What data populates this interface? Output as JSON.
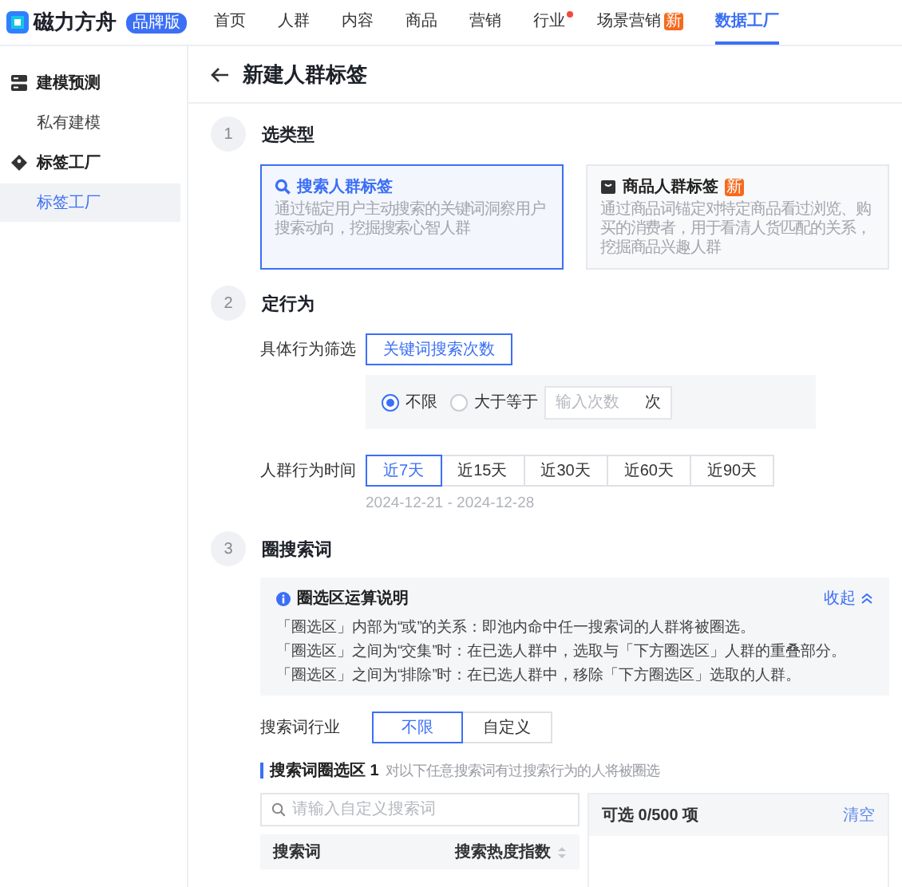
{
  "nav": {
    "logo": "磁力方舟",
    "edition": "品牌版",
    "items": [
      {
        "label": "首页",
        "selected": false,
        "dot": false
      },
      {
        "label": "人群",
        "selected": false,
        "dot": false
      },
      {
        "label": "内容",
        "selected": false,
        "dot": false
      },
      {
        "label": "商品",
        "selected": false,
        "dot": false
      },
      {
        "label": "营销",
        "selected": false,
        "dot": false
      },
      {
        "label": "行业",
        "selected": false,
        "dot": true
      },
      {
        "label": "场景营销",
        "selected": false,
        "dot": false,
        "badge": "新"
      },
      {
        "label": "数据工厂",
        "selected": true,
        "dot": false
      }
    ]
  },
  "sidebar": {
    "groups": [
      {
        "label": "建模预测",
        "kind": "server",
        "items": [
          {
            "label": "私有建模",
            "selected": false
          }
        ]
      },
      {
        "label": "标签工厂",
        "kind": "tag",
        "items": [
          {
            "label": "标签工厂",
            "selected": true
          }
        ]
      }
    ]
  },
  "page_title": "新建人群标签",
  "type_step": {
    "number": "1",
    "title": "选类型",
    "cards": [
      {
        "kind": "search",
        "title": "搜索人群标签",
        "description": "通过锚定用户主动搜索的关键词洞察用户搜索动向，挖掘搜索心智人群",
        "selected": true
      },
      {
        "kind": "bag",
        "title": "商品人群标签",
        "badge": "新",
        "description": "通过商品词锚定对特定商品看过浏览、购买的消费者，用于看清人货匹配的关系，挖掘商品兴趣人群",
        "selected": false
      }
    ]
  },
  "behavior_step": {
    "number": "2",
    "title": "定行为",
    "filter": {
      "label": "具体行为筛选",
      "option": "关键词搜索次数",
      "radios": [
        {
          "label": "不限",
          "selected": true
        },
        {
          "label": "大于等于",
          "selected": false
        }
      ],
      "count_field": {
        "placeholder": "输入次数",
        "unit": "次"
      }
    },
    "time": {
      "label": "人群行为时间",
      "options": [
        {
          "label": "近7天",
          "selected": true
        },
        {
          "label": "近15天",
          "selected": false
        },
        {
          "label": "近30天",
          "selected": false
        },
        {
          "label": "近60天",
          "selected": false
        },
        {
          "label": "近90天",
          "selected": false
        }
      ],
      "range": "2024-12-21 - 2024-12-28"
    }
  },
  "keyword_step": {
    "number": "3",
    "title": "圈搜索词",
    "info": {
      "title": "圈选区运算说明",
      "toggle": "收起",
      "lines": [
        "「圈选区」内部为“或”的关系：即池内命中任一搜索词的人群将被圈选。",
        "「圈选区」之间为“交集”时：在已选人群中，选取与「下方圈选区」人群的重叠部分。",
        "「圈选区」之间为“排除”时：在已选人群中，移除「下方圈选区」选取的人群。"
      ]
    },
    "industry": {
      "label": "搜索词行业",
      "options": [
        {
          "label": "不限",
          "selected": true
        },
        {
          "label": "自定义",
          "selected": false
        }
      ]
    },
    "zone": {
      "title": "搜索词圈选区",
      "index": "1",
      "hint": "对以下任意搜索词有过搜索行为的人将被圈选",
      "search": {
        "placeholder": "请输入自定义搜索词"
      },
      "columns": [
        "搜索词",
        "搜索热度指数"
      ],
      "selected_count": "可选 0/500 项",
      "clear": "清空"
    }
  }
}
